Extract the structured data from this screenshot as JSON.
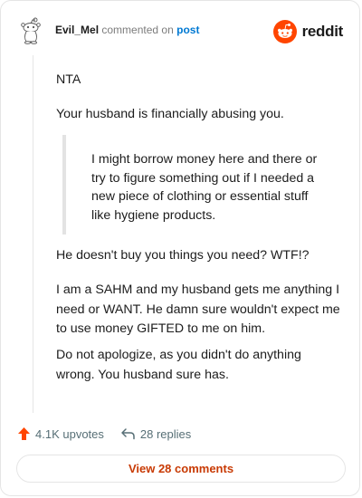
{
  "header": {
    "username": "Evil_Mel",
    "commented_text": "commented on",
    "post_link": "post",
    "logo_text": "reddit"
  },
  "comment": {
    "p1": "NTA",
    "p2": "Your husband is financially abusing you.",
    "quote_lines": [
      "I might borrow money here and there or",
      "try to figure something out if I needed a",
      "new piece of clothing or essential stuff",
      "like hygiene products."
    ],
    "p3": "He doesn't buy you things you need? WTF!?",
    "p4_lines": [
      "I am a SAHM and my husband gets me anything I",
      "need or WANT. He damn sure wouldn't expect me",
      "to use money GIFTED to me on him."
    ],
    "p5_lines": [
      "Do not apologize, as you didn't do anything",
      "wrong. You husband sure has."
    ]
  },
  "actions": {
    "upvotes": "4.1K upvotes",
    "replies": "28 replies"
  },
  "view_button": "View 28 comments",
  "colors": {
    "brand": "#ff4500",
    "link": "#0079d3",
    "view_button_text": "#c83a04"
  },
  "icons": [
    "snoo-avatar-icon",
    "reddit-logo-icon",
    "upvote-arrow-icon",
    "reply-arrow-icon"
  ]
}
